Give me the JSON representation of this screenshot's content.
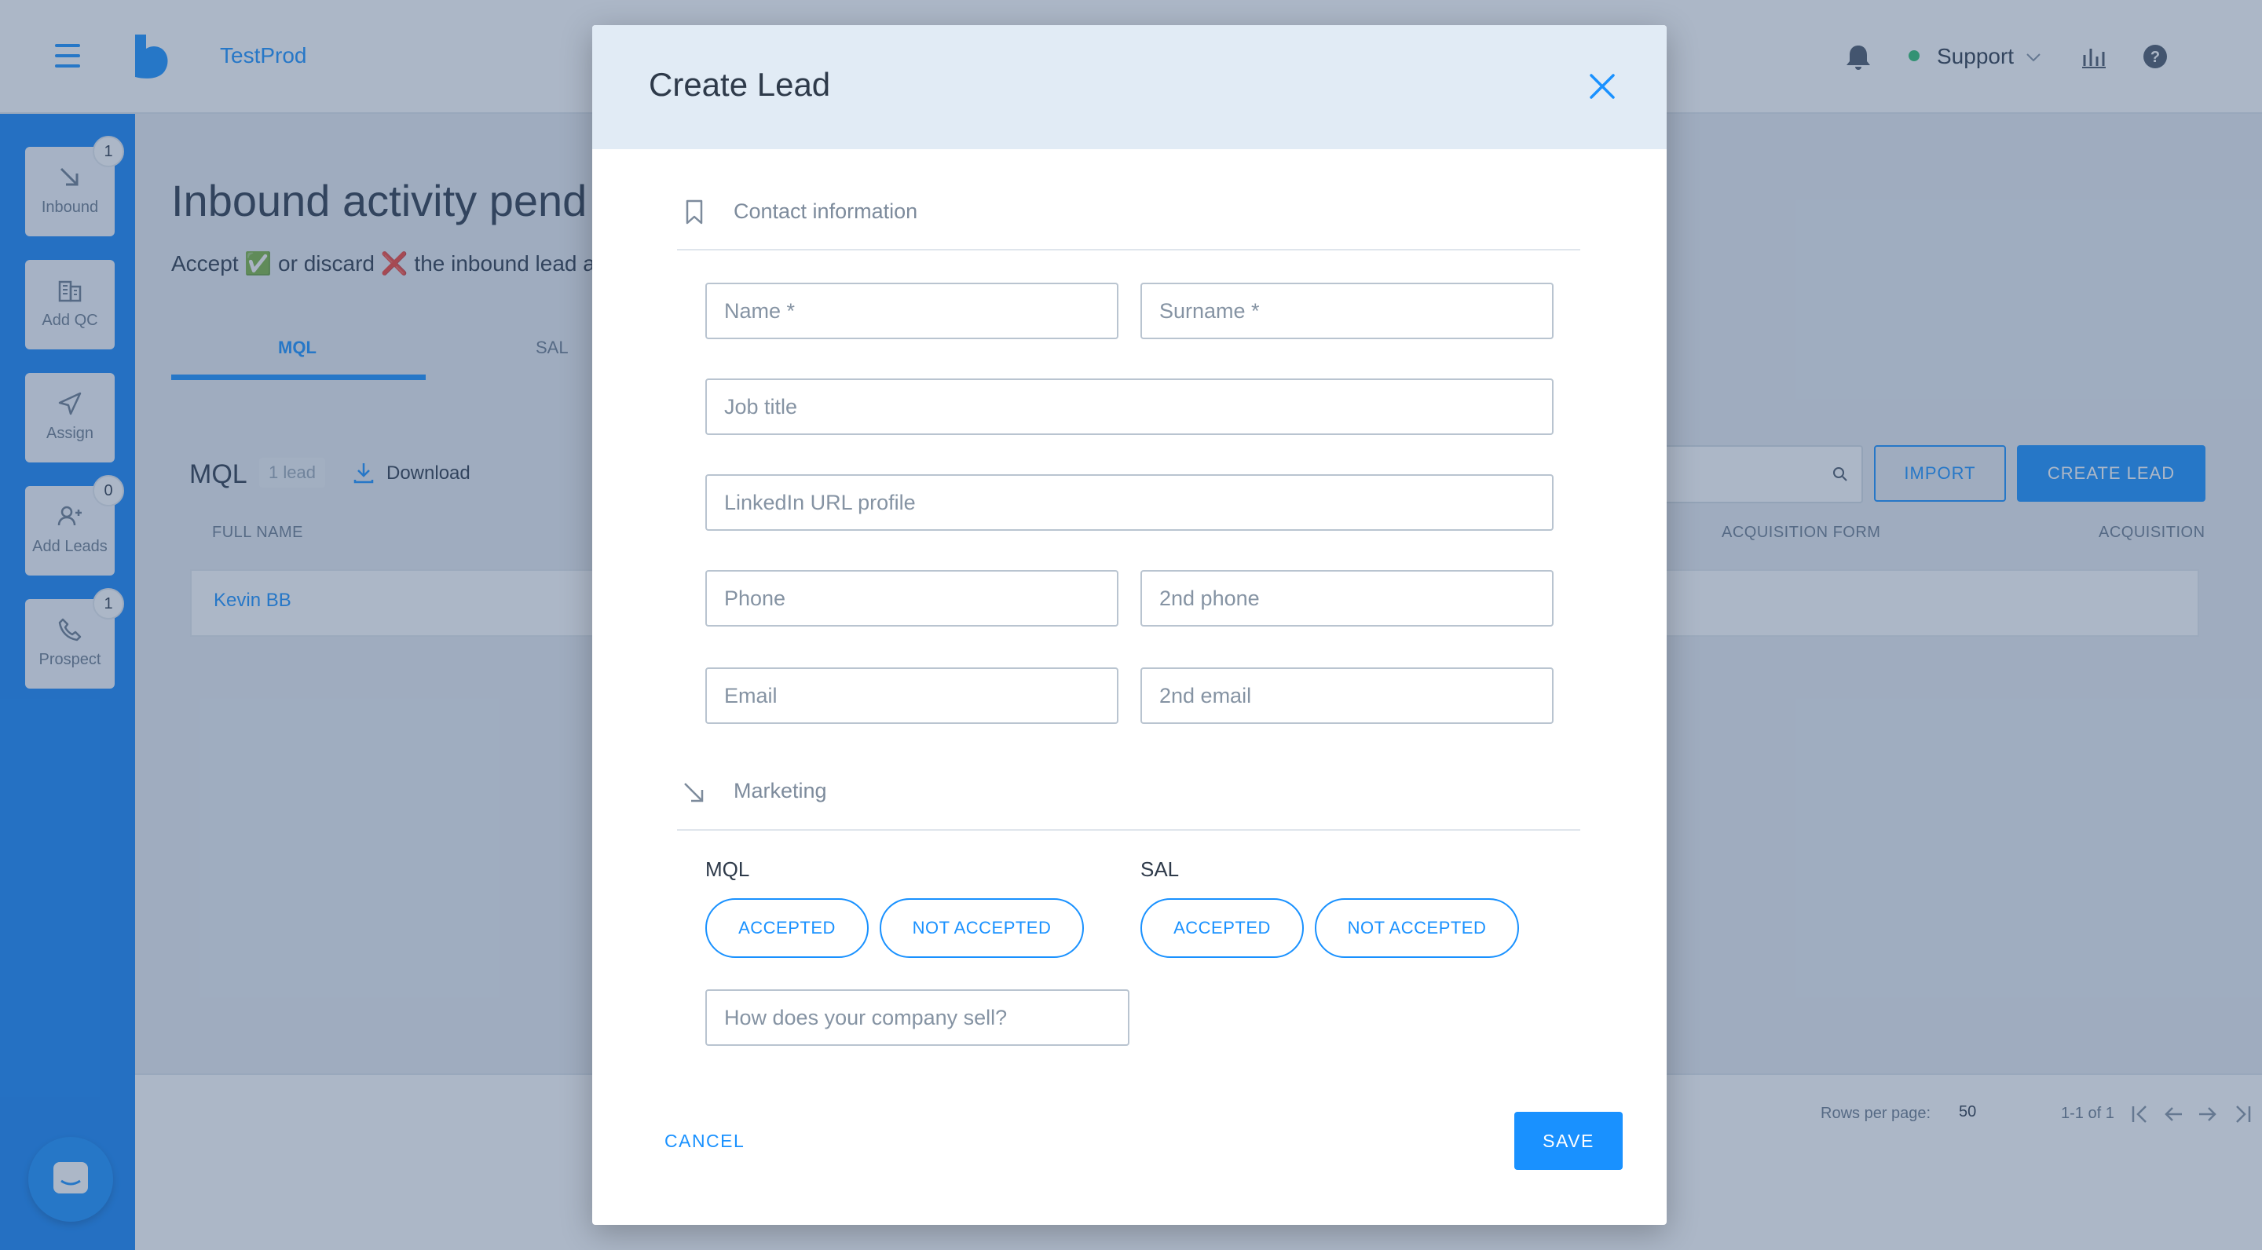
{
  "app": {
    "name": "TestProd"
  },
  "header": {
    "support_label": "Support",
    "status_color": "#2fbf71"
  },
  "sidebar": {
    "items": [
      {
        "label": "Inbound",
        "badge": "1",
        "icon": "arrow-down-right-icon"
      },
      {
        "label": "Add QC",
        "badge": "",
        "icon": "building-icon"
      },
      {
        "label": "Assign",
        "badge": "",
        "icon": "send-icon"
      },
      {
        "label": "Add Leads",
        "badge": "0",
        "icon": "add-user-icon"
      },
      {
        "label": "Prospect",
        "badge": "1",
        "icon": "phone-icon"
      }
    ]
  },
  "page": {
    "title": "Inbound activity pend",
    "subtitle_parts": [
      "Accept",
      "✅",
      "or discard",
      "❌",
      "the inbound lead a"
    ],
    "tabs": [
      "MQL",
      "SAL"
    ],
    "list_title": "MQL",
    "lead_count": "1 lead",
    "download_label": "Download",
    "import_label": "IMPORT",
    "create_label": "CREATE LEAD",
    "columns": [
      "FULL NAME",
      "ACQUISITION FORM",
      "ACQUISITION"
    ],
    "rows": [
      {
        "full_name": "Kevin BB"
      }
    ],
    "rows_per_page_label": "Rows per page:",
    "rows_per_page": "50",
    "range": "1-1 of 1"
  },
  "modal": {
    "title": "Create Lead",
    "contact_section": "Contact information",
    "marketing_section": "Marketing",
    "fields": {
      "name": "Name *",
      "surname": "Surname *",
      "job_title": "Job title",
      "linkedin": "LinkedIn URL profile",
      "phone": "Phone",
      "phone2": "2nd phone",
      "email": "Email",
      "email2": "2nd email",
      "company_sell": "How does your company sell?"
    },
    "mql_label": "MQL",
    "sal_label": "SAL",
    "accepted": "ACCEPTED",
    "not_accepted": "NOT ACCEPTED",
    "cancel": "CANCEL",
    "save": "SAVE"
  },
  "colors": {
    "accent": "#1991ff",
    "sidebar": "#1786f7",
    "overlay": "rgba(57,84,122,0.42)"
  }
}
